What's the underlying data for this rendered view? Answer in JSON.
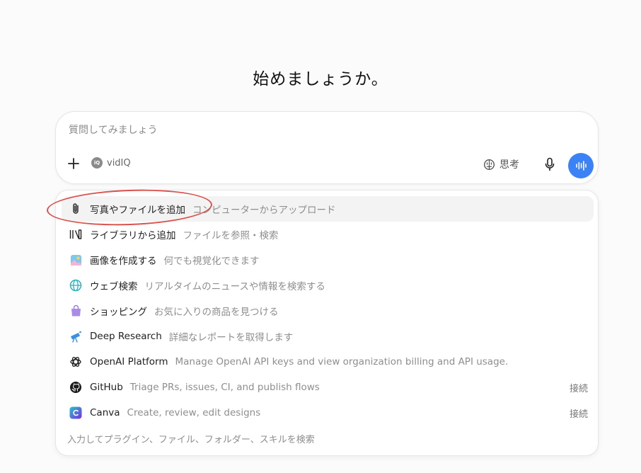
{
  "title": "始めましょうか。",
  "composer": {
    "placeholder": "質問してみましょう",
    "plugin_chip": "vidIQ",
    "think_label": "思考"
  },
  "menu": {
    "items": [
      {
        "label": "写真やファイルを追加",
        "desc": "コンピューターからアップロード",
        "icon": "paperclip-icon",
        "action": ""
      },
      {
        "label": "ライブラリから追加",
        "desc": "ファイルを参照・検索",
        "icon": "library-icon",
        "action": ""
      },
      {
        "label": "画像を作成する",
        "desc": "何でも視覚化できます",
        "icon": "image-icon",
        "action": ""
      },
      {
        "label": "ウェブ検索",
        "desc": "リアルタイムのニュースや情報を検索する",
        "icon": "globe-icon",
        "action": ""
      },
      {
        "label": "ショッピング",
        "desc": "お気に入りの商品を見つける",
        "icon": "shopping-bag-icon",
        "action": ""
      },
      {
        "label": "Deep Research",
        "desc": "詳細なレポートを取得します",
        "icon": "telescope-icon",
        "action": ""
      },
      {
        "label": "OpenAI Platform",
        "desc": "Manage OpenAI API keys and view organization billing and API usage.",
        "icon": "openai-icon",
        "action": ""
      },
      {
        "label": "GitHub",
        "desc": "Triage PRs, issues, CI, and publish flows",
        "icon": "github-icon",
        "action": "接続"
      },
      {
        "label": "Canva",
        "desc": "Create, review, edit designs",
        "icon": "canva-icon",
        "action": "接続"
      }
    ],
    "footer": "入力してプラグイン、ファイル、フォルダー、スキルを検索"
  },
  "colors": {
    "accent": "#3b82f6",
    "annotation": "#d9534f"
  }
}
